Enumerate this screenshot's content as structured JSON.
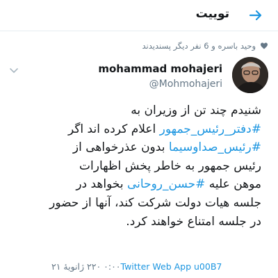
{
  "header": {
    "title": "توییت"
  },
  "liked_by": {
    "text": "وحید باسره و 6 نفر دیگر پسندیدند"
  },
  "author": {
    "display_name": "mohammad mohajeri",
    "username": "@Mohmohajeri"
  },
  "tweet": {
    "lines": [
      [
        {
          "text": "شنیدم چند تن از وزیران به",
          "hashtag": false
        }
      ],
      [
        {
          "text": "#دفتر_رئیس_جمهور",
          "hashtag": true
        },
        {
          "text": " اعلام کرده اند اگر",
          "hashtag": false
        }
      ],
      [
        {
          "text": "#رئیس_صداوسیما",
          "hashtag": true
        },
        {
          "text": " بدون عذرخواهی از",
          "hashtag": false
        }
      ],
      [
        {
          "text": "رئیس جمهور به خاطر پخش  اظهارات",
          "hashtag": false
        }
      ],
      [
        {
          "text": "موهن علیه ",
          "hashtag": false
        },
        {
          "text": "#حسن_روحانی",
          "hashtag": true
        },
        {
          "text": " بخواهد در",
          "hashtag": false
        }
      ],
      [
        {
          "text": "جلسه هیات دولت شرکت کند، آنها از حضور",
          "hashtag": false
        }
      ],
      [
        {
          "text": "در جلسه امتناع خواهند کرد.",
          "hashtag": false
        }
      ]
    ]
  },
  "footer": {
    "date": "۰:۰۰ ۲۲۰ ژانویهٔ ۲۱",
    "app": "Twitter Web App u00B7"
  },
  "colors": {
    "link": "#1b95e0",
    "secondary": "#657786",
    "text": "#14171a"
  },
  "icons": {
    "back": "arrow-right-icon",
    "like": "heart-icon",
    "menu": "chevron-down-icon"
  }
}
